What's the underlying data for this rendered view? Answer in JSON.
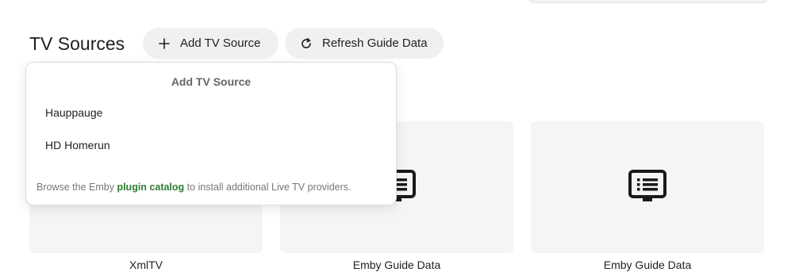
{
  "header": {
    "title": "TV Sources"
  },
  "toolbar": {
    "add_label": "Add TV Source",
    "refresh_label": "Refresh Guide Data"
  },
  "dropdown": {
    "title": "Add TV Source",
    "items": [
      {
        "label": "Hauppauge"
      },
      {
        "label": "HD Homerun"
      }
    ],
    "footer_prefix": "Browse the Emby",
    "footer_link": "plugin catalog",
    "footer_suffix": "to install additional Live TV providers."
  },
  "cards": [
    {
      "label": "XmlTV",
      "icon": "guide-icon"
    },
    {
      "label": "Emby Guide Data",
      "icon": "guide-icon"
    },
    {
      "label": "Emby Guide Data",
      "icon": "guide-icon"
    }
  ],
  "colors": {
    "accent_link": "#2e7d32",
    "button_bg": "#f0f0f3",
    "card_bg": "#f5f5f7"
  }
}
